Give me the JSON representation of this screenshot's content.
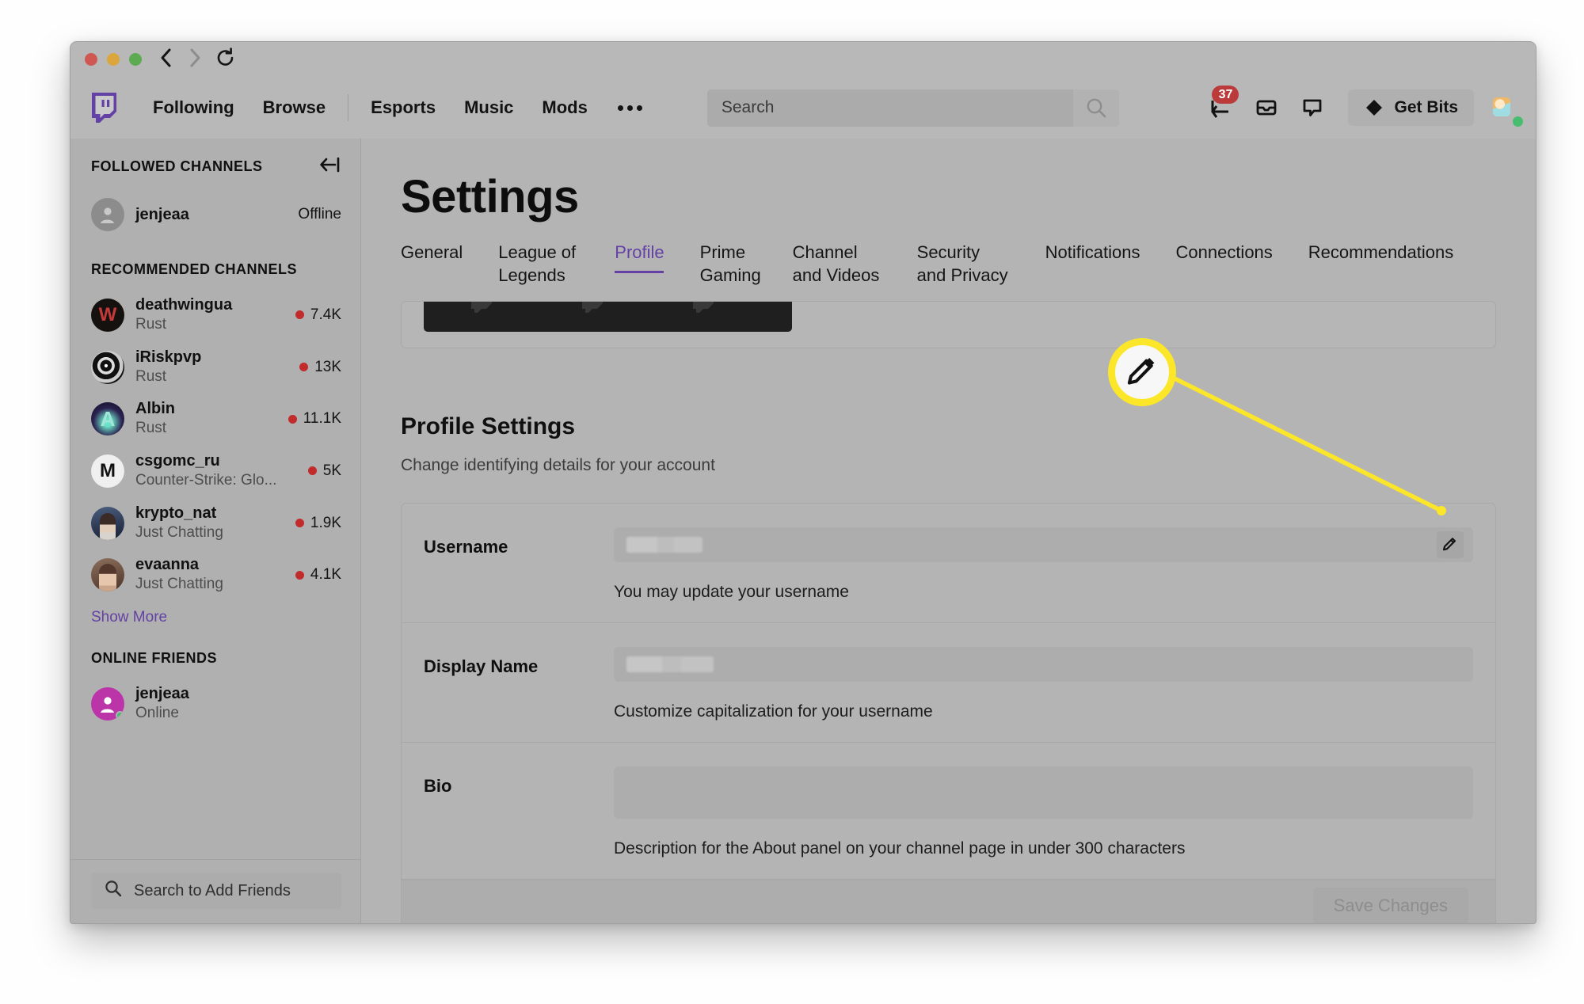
{
  "window": {
    "traffic_lights": [
      "close",
      "minimize",
      "zoom"
    ],
    "nav": {
      "back": "‹",
      "forward": "›",
      "reload": "⟳"
    }
  },
  "topnav": {
    "logo": "twitch-glitch-logo",
    "links": [
      "Following",
      "Browse",
      "Esports",
      "Music",
      "Mods"
    ],
    "more_label": "more-options",
    "search": {
      "placeholder": "Search",
      "value": "",
      "icon": "search-icon"
    },
    "right": {
      "inbox_icon": "arrow-into-tray-icon",
      "notifications_badge": "37",
      "messages_icon": "mail-inbox-icon",
      "whispers_icon": "chat-bubble-icon",
      "get_bits_label": "Get Bits",
      "bits_icon": "bits-diamond-icon",
      "avatar": "user-avatar",
      "presence": "online"
    }
  },
  "sidebar": {
    "followed_title": "FOLLOWED CHANNELS",
    "collapse_icon": "collapse-sidebar-icon",
    "followed": [
      {
        "name": "jenjeaa",
        "status": "Offline",
        "avatar": "generic-avatar"
      }
    ],
    "recommended_title": "RECOMMENDED CHANNELS",
    "recommended": [
      {
        "name": "deathwingua",
        "game": "Rust",
        "viewers": "7.4K",
        "avatar": "deathwingua-avatar"
      },
      {
        "name": "iRiskpvp",
        "game": "Rust",
        "viewers": "13K",
        "avatar": "iriskpvp-avatar"
      },
      {
        "name": "Albin",
        "game": "Rust",
        "viewers": "11.1K",
        "avatar": "albin-avatar"
      },
      {
        "name": "csgomc_ru",
        "game": "Counter-Strike: Glo...",
        "viewers": "5K",
        "avatar": "csgomc-avatar"
      },
      {
        "name": "krypto_nat",
        "game": "Just Chatting",
        "viewers": "1.9K",
        "avatar": "krypto-avatar"
      },
      {
        "name": "evaanna",
        "game": "Just Chatting",
        "viewers": "4.1K",
        "avatar": "evaanna-avatar"
      }
    ],
    "show_more": "Show More",
    "online_friends_title": "ONLINE FRIENDS",
    "friends": [
      {
        "name": "jenjeaa",
        "status": "Online",
        "avatar": "pink-avatar"
      }
    ],
    "friend_search_placeholder": "Search to Add Friends",
    "friend_search_icon": "search-icon"
  },
  "main": {
    "title": "Settings",
    "tabs": [
      {
        "label": "General",
        "active": false
      },
      {
        "label": "League of Legends",
        "active": false
      },
      {
        "label": "Profile",
        "active": true
      },
      {
        "label": "Prime Gaming",
        "active": false
      },
      {
        "label": "Channel and Videos",
        "active": false
      },
      {
        "label": "Security and Privacy",
        "active": false
      },
      {
        "label": "Notifications",
        "active": false
      },
      {
        "label": "Connections",
        "active": false
      },
      {
        "label": "Recommendations",
        "active": false
      }
    ],
    "section": {
      "heading": "Profile Settings",
      "subheading": "Change identifying details for your account"
    },
    "fields": [
      {
        "label": "Username",
        "value": "",
        "redacted": true,
        "redacted_width": 96,
        "hint": "You may update your username",
        "edit_icon": "pencil-edit-icon",
        "has_edit": true
      },
      {
        "label": "Display Name",
        "value": "",
        "redacted": true,
        "redacted_width": 110,
        "hint": "Customize capitalization for your username",
        "edit_icon": "",
        "has_edit": false
      },
      {
        "label": "Bio",
        "value": "",
        "redacted": false,
        "redacted_width": 0,
        "hint": "Description for the About panel on your channel page in under 300 characters",
        "edit_icon": "",
        "has_edit": false
      }
    ],
    "save_label": "Save Changes"
  },
  "annotation": {
    "icon": "pencil-edit-icon",
    "highlight_color": "#fbe629",
    "target": "username-edit-pencil"
  },
  "colors": {
    "twitch_purple": "#6441a5",
    "live_red": "#c22b2b",
    "badge_red": "#bb3b3b",
    "online_green": "#49bd6e",
    "annotation_yellow": "#fbe629"
  }
}
